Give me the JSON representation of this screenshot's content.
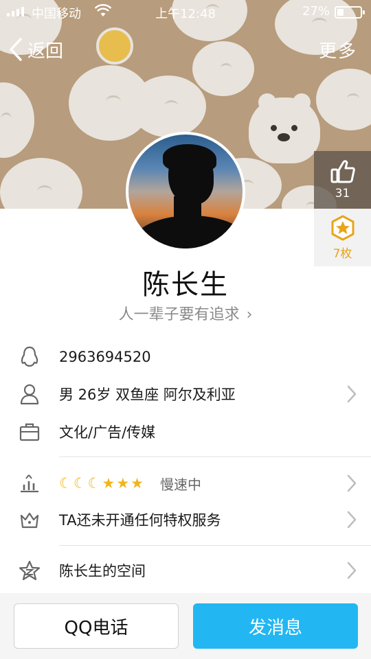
{
  "status_bar": {
    "carrier": "中国移动",
    "time": "上午12:48",
    "battery_percent": "27%",
    "battery_level": 0.27
  },
  "nav": {
    "back_label": "返回",
    "more_label": "更多"
  },
  "side": {
    "like_count": "31",
    "gift_label": "7枚"
  },
  "profile": {
    "name": "陈长生",
    "signature": "人一辈子要有追求",
    "signature_chevron": "›"
  },
  "info": {
    "qq_number": "2963694520",
    "basic": "男  26岁  双鱼座  阿尔及利亚",
    "occupation": "文化/广告/传媒",
    "level_icons": {
      "moons": [
        "☾",
        "☾",
        "☾"
      ],
      "stars": [
        "★",
        "★",
        "★"
      ]
    },
    "level_status": "慢速中",
    "privilege": "TA还未开通任何特权服务",
    "space": "陈长生的空间"
  },
  "bottom": {
    "call_label": "QQ电话",
    "message_label": "发消息"
  },
  "colors": {
    "cover_bg": "#b79c7d",
    "accent_blue": "#22b7f2",
    "gift_gold": "#e8a41a"
  }
}
